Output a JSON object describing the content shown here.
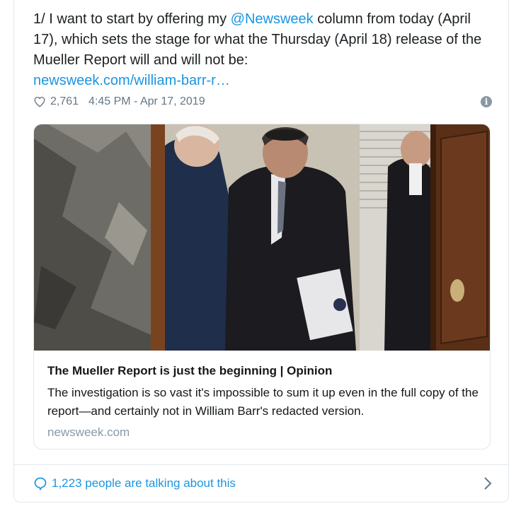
{
  "tweet": {
    "text_before": "1/ I want to start by offering my ",
    "mention": "@Newsweek",
    "text_after": " column from today (April 17), which sets the stage for what the Thursday (April 18) release of the Mueller Report will and will not be:",
    "link_text": "newsweek.com/william-barr-r…",
    "like_count": "2,761",
    "timestamp": "4:45 PM - Apr 17, 2019",
    "info_icon": "info-icon"
  },
  "link_card": {
    "title": "The Mueller Report is just the beginning | Opinion",
    "description": "The investigation is so vast it's impossible to sum it up even in the full copy of the report—and certainly not in William Barr's redacted version.",
    "domain": "newsweek.com"
  },
  "footer": {
    "talking_text": "1,223 people are talking about this",
    "icons": [
      "speech-bubble-icon",
      "chevron-right-icon"
    ]
  },
  "colors": {
    "link_blue": "#1b95e0",
    "muted_gray": "#657786",
    "border": "#e1e8ed"
  }
}
